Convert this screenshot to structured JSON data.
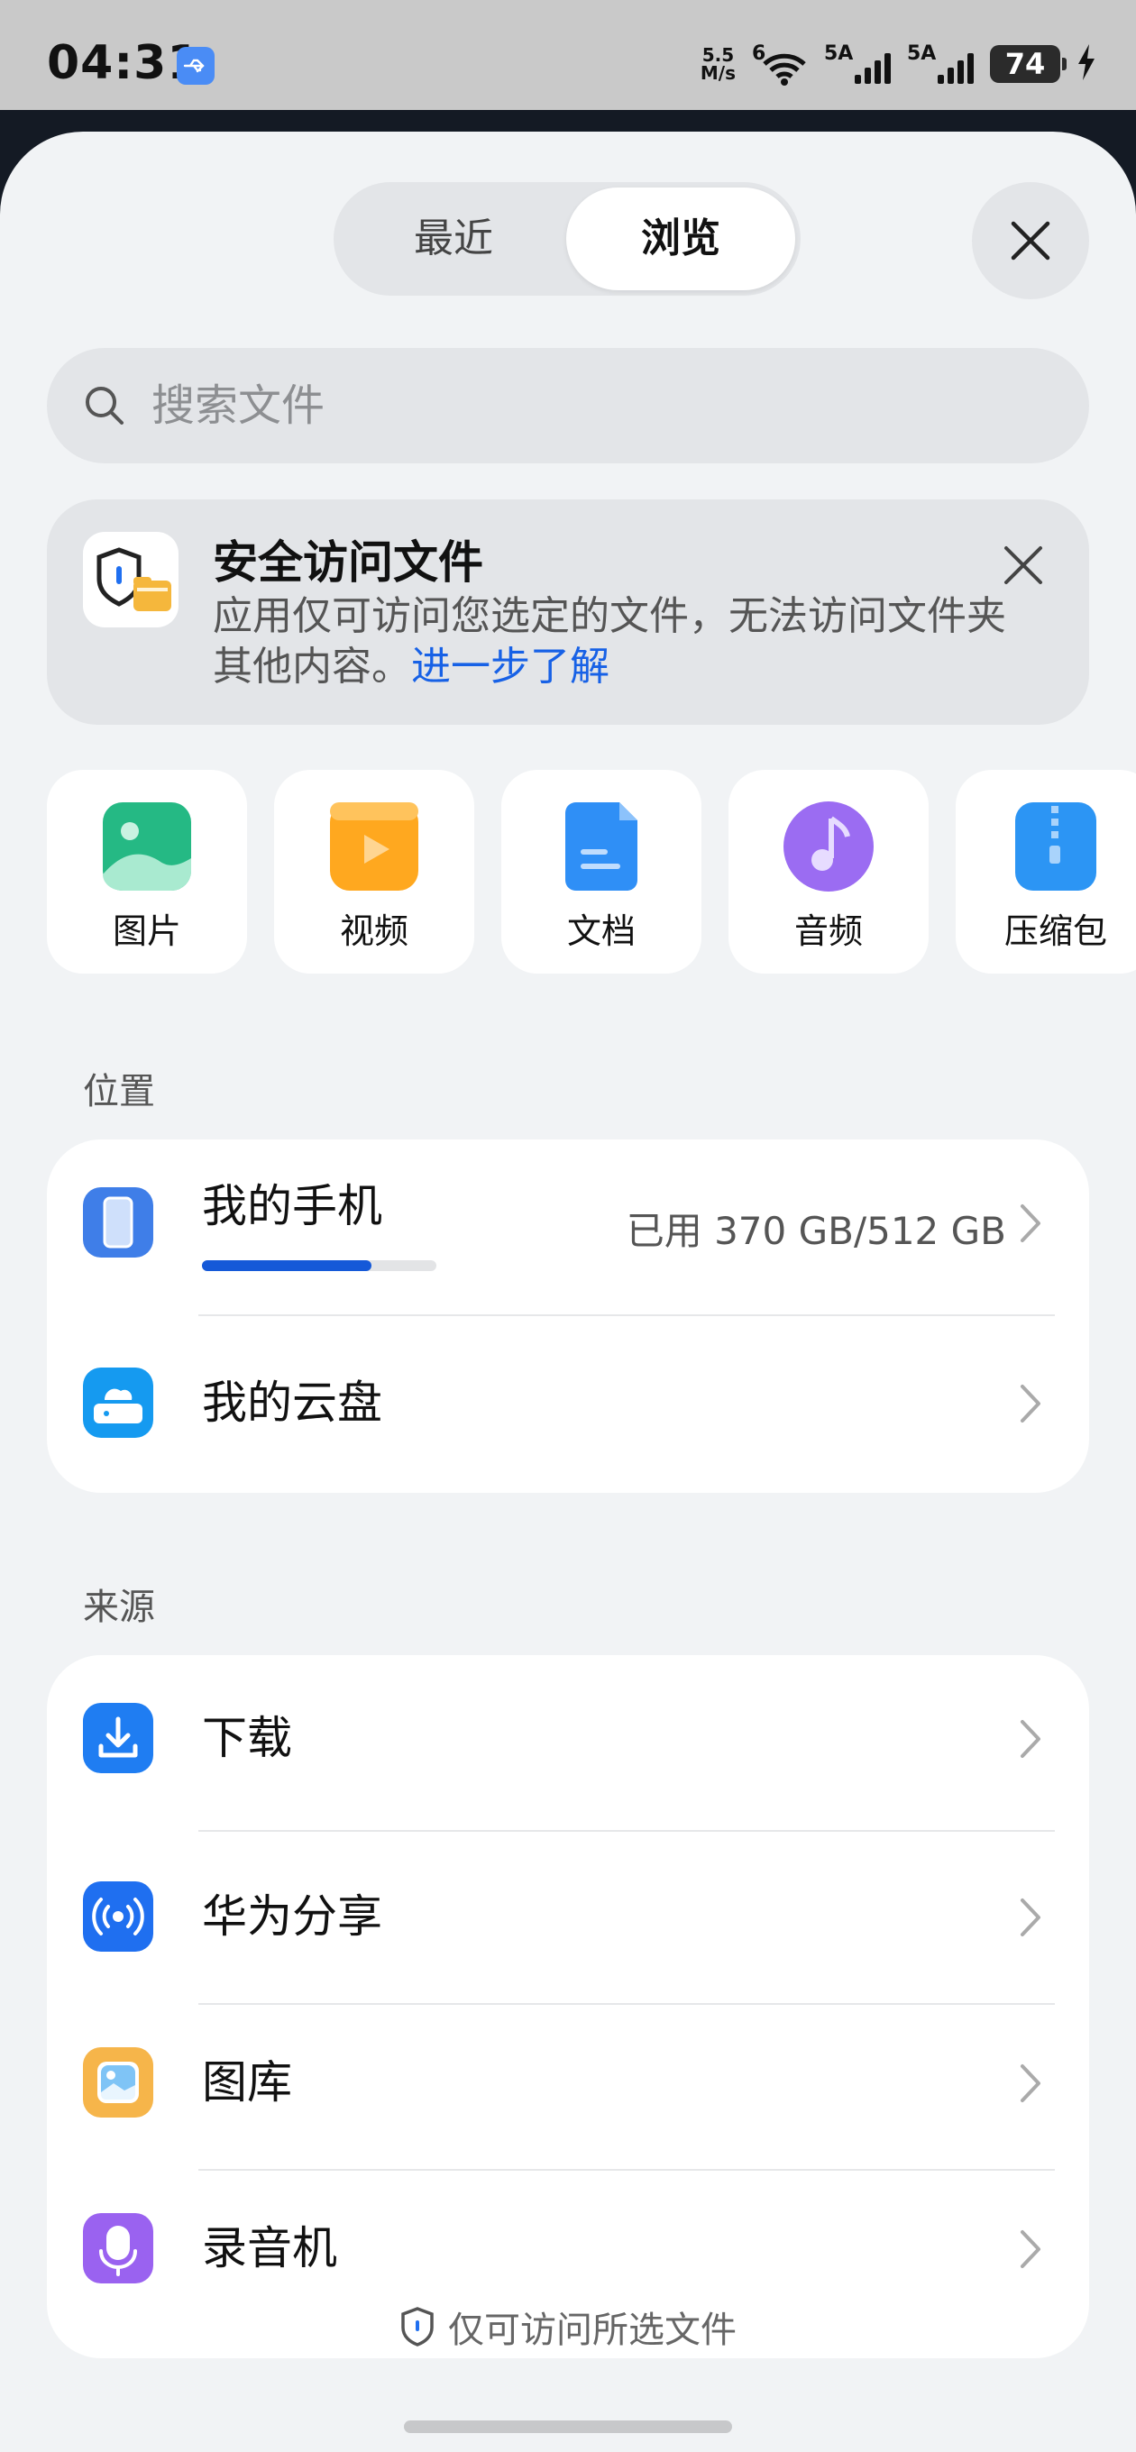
{
  "status": {
    "time": "04:31",
    "net_speed_top": "5.5",
    "net_speed_bottom": "M/s",
    "wifi_label": "6",
    "sim1_label": "5A",
    "sim2_label": "5A",
    "battery": "74"
  },
  "tabs": {
    "recent": "最近",
    "browse": "浏览"
  },
  "search": {
    "placeholder": "搜索文件"
  },
  "info": {
    "title": "安全访问文件",
    "desc": "应用仅可访问您选定的文件，无法访问文件夹其他内容。",
    "link": "进一步了解"
  },
  "categories": [
    {
      "label": "图片",
      "icon": "image-icon",
      "color": "#25b984"
    },
    {
      "label": "视频",
      "icon": "video-icon",
      "color": "#ffa81f"
    },
    {
      "label": "文档",
      "icon": "document-icon",
      "color": "#2f8ff6"
    },
    {
      "label": "音频",
      "icon": "audio-icon",
      "color": "#9b6cf2"
    },
    {
      "label": "压缩包",
      "icon": "archive-icon",
      "color": "#2c95f4"
    }
  ],
  "location": {
    "title": "位置",
    "phone": {
      "label": "我的手机",
      "usage": "已用 370 GB/512 GB",
      "used_fraction": 0.7227
    },
    "cloud": {
      "label": "我的云盘"
    }
  },
  "sources": {
    "title": "来源",
    "items": [
      {
        "label": "下载",
        "icon": "download-icon",
        "color": "#1f7df2"
      },
      {
        "label": "华为分享",
        "icon": "huawei-share-icon",
        "color": "#1f6ff0"
      },
      {
        "label": "图库",
        "icon": "gallery-icon",
        "color": "#f6b54a"
      },
      {
        "label": "录音机",
        "icon": "recorder-icon",
        "color": "#9a62f0"
      }
    ]
  },
  "footer": {
    "note": "仅可访问所选文件"
  }
}
